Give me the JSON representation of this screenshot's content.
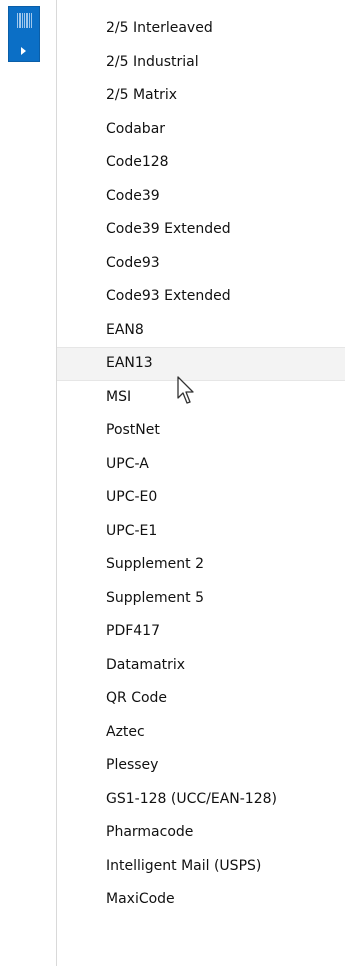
{
  "button": {
    "icon": "barcode-icon",
    "arrow_icon": "chevron-right-icon",
    "accent_color": "#0b6fc6"
  },
  "menu": {
    "hovered_item": "EAN13",
    "items": [
      {
        "label": "2/5 Interleaved"
      },
      {
        "label": "2/5 Industrial"
      },
      {
        "label": "2/5 Matrix"
      },
      {
        "label": "Codabar"
      },
      {
        "label": "Code128"
      },
      {
        "label": "Code39"
      },
      {
        "label": "Code39 Extended"
      },
      {
        "label": "Code93"
      },
      {
        "label": "Code93 Extended"
      },
      {
        "label": "EAN8"
      },
      {
        "label": "EAN13"
      },
      {
        "label": "MSI"
      },
      {
        "label": "PostNet"
      },
      {
        "label": "UPC-A"
      },
      {
        "label": "UPC-E0"
      },
      {
        "label": "UPC-E1"
      },
      {
        "label": "Supplement 2"
      },
      {
        "label": "Supplement 5"
      },
      {
        "label": "PDF417"
      },
      {
        "label": "Datamatrix"
      },
      {
        "label": "QR Code"
      },
      {
        "label": "Aztec"
      },
      {
        "label": "Plessey"
      },
      {
        "label": "GS1-128 (UCC/EAN-128)"
      },
      {
        "label": "Pharmacode"
      },
      {
        "label": "Intelligent Mail (USPS)"
      },
      {
        "label": "MaxiCode"
      }
    ]
  }
}
